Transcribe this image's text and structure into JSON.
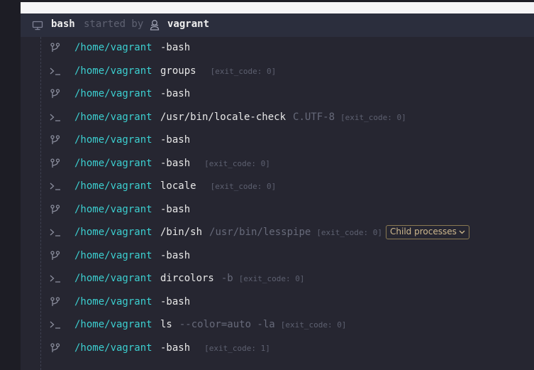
{
  "header": {
    "title": "bash",
    "started_by": "started by",
    "user": "vagrant"
  },
  "rows": [
    {
      "icon": "branch-icon",
      "path": "/home/vagrant",
      "cmd": "-bash",
      "arg": "",
      "exit": ""
    },
    {
      "icon": "terminal-icon",
      "path": "/home/vagrant",
      "cmd": "groups",
      "arg": "",
      "exit": "[exit_code: 0]"
    },
    {
      "icon": "branch-icon",
      "path": "/home/vagrant",
      "cmd": "-bash",
      "arg": "",
      "exit": ""
    },
    {
      "icon": "terminal-icon",
      "path": "/home/vagrant",
      "cmd": "/usr/bin/locale-check",
      "arg": "C.UTF-8",
      "exit": "[exit_code: 0]"
    },
    {
      "icon": "branch-icon",
      "path": "/home/vagrant",
      "cmd": "-bash",
      "arg": "",
      "exit": ""
    },
    {
      "icon": "branch-icon",
      "path": "/home/vagrant",
      "cmd": "-bash",
      "arg": "",
      "exit": "[exit_code: 0]"
    },
    {
      "icon": "terminal-icon",
      "path": "/home/vagrant",
      "cmd": "locale",
      "arg": "",
      "exit": "[exit_code: 0]"
    },
    {
      "icon": "branch-icon",
      "path": "/home/vagrant",
      "cmd": "-bash",
      "arg": "",
      "exit": ""
    },
    {
      "icon": "terminal-icon",
      "path": "/home/vagrant",
      "cmd": "/bin/sh",
      "arg": "/usr/bin/lesspipe",
      "exit": "[exit_code: 0]",
      "chip": "Child processes"
    },
    {
      "icon": "branch-icon",
      "path": "/home/vagrant",
      "cmd": "-bash",
      "arg": "",
      "exit": ""
    },
    {
      "icon": "terminal-icon",
      "path": "/home/vagrant",
      "cmd": "dircolors",
      "arg": "-b",
      "exit": "[exit_code: 0]"
    },
    {
      "icon": "branch-icon",
      "path": "/home/vagrant",
      "cmd": "-bash",
      "arg": "",
      "exit": ""
    },
    {
      "icon": "terminal-icon",
      "path": "/home/vagrant",
      "cmd": "ls",
      "arg": "--color=auto -la",
      "exit": "[exit_code: 0]"
    },
    {
      "icon": "branch-icon",
      "path": "/home/vagrant",
      "cmd": "-bash",
      "arg": "",
      "exit": "[exit_code: 1]"
    }
  ],
  "colors": {
    "path": "#3ccfd0",
    "chip": "#cfb98e"
  }
}
